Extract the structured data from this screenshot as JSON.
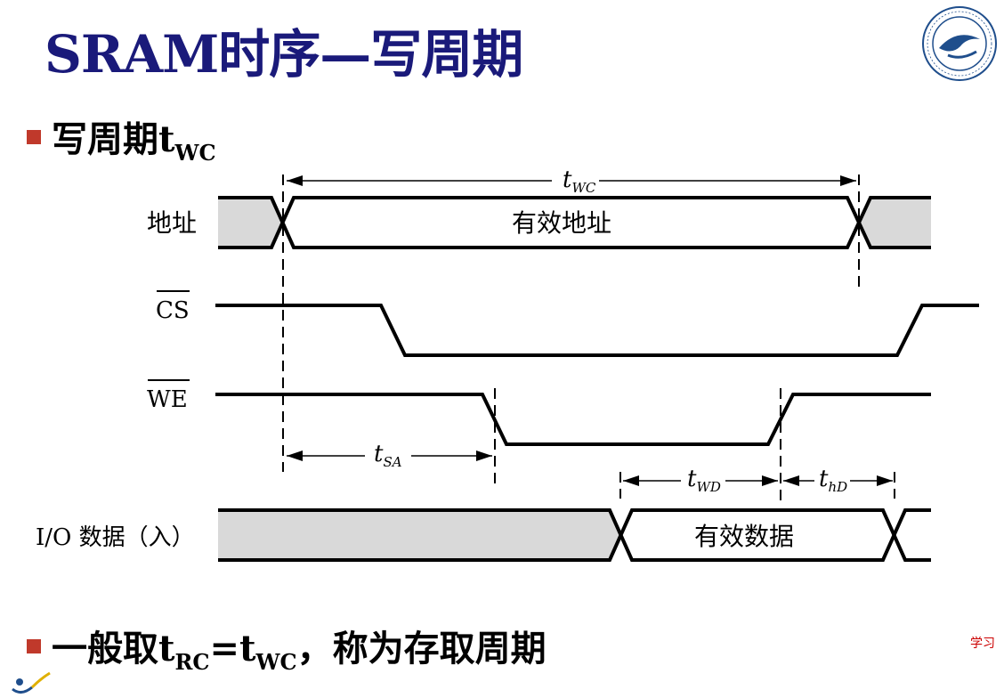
{
  "slide": {
    "title": "SRAM时序—写周期",
    "bullet1": {
      "text": "写周期t",
      "sub": "WC"
    },
    "bullet2": {
      "part1": "一般取t",
      "sub1": "RC",
      "mid": "=t",
      "sub2": "WC",
      "part2": "，称为存取周期"
    },
    "side_note": "学习"
  },
  "diagram": {
    "signals": {
      "address": "地址",
      "cs": "CS",
      "we": "WE",
      "io": "I/O 数据（入）"
    },
    "bus_labels": {
      "valid_address": "有效地址",
      "valid_data": "有效数据"
    },
    "timing": {
      "twc": {
        "main": "t",
        "sub": "WC"
      },
      "tsa": {
        "main": "t",
        "sub": "SA"
      },
      "twd": {
        "main": "t",
        "sub": "WD"
      },
      "thd": {
        "main": "t",
        "sub": "hD"
      }
    }
  },
  "colors": {
    "title": "#1a1a7a",
    "bullet": "#c0392b",
    "shade": "#d9d9d9",
    "line": "#000000"
  }
}
